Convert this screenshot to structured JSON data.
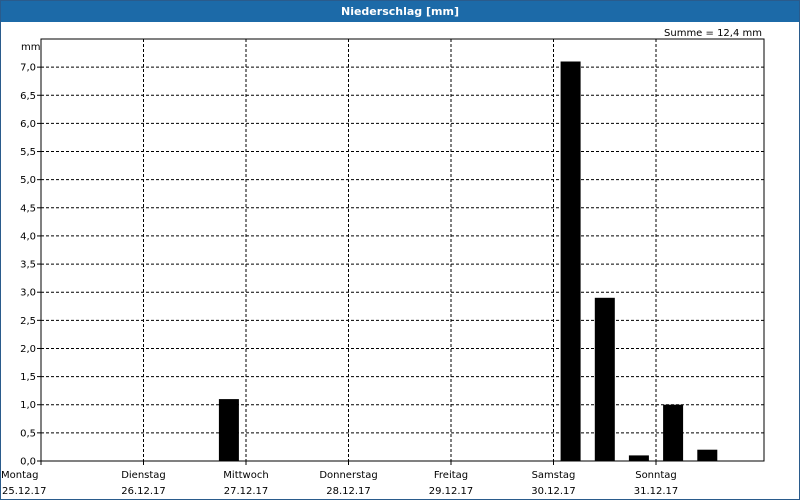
{
  "window": {
    "title": "Niederschlag [mm]"
  },
  "chart_data": {
    "type": "bar",
    "title": "Niederschlag [mm]",
    "ylabel": "mm",
    "summary": "Summe = 12,4 mm",
    "ylim": [
      0,
      7.5
    ],
    "yticks": [
      "0,0",
      "0,5",
      "1,0",
      "1,5",
      "2,0",
      "2,5",
      "3,0",
      "3,5",
      "4,0",
      "4,5",
      "5,0",
      "5,5",
      "6,0",
      "6,5",
      "7,0"
    ],
    "ytick_values": [
      0,
      0.5,
      1.0,
      1.5,
      2.0,
      2.5,
      3.0,
      3.5,
      4.0,
      4.5,
      5.0,
      5.5,
      6.0,
      6.5,
      7.0
    ],
    "days": [
      {
        "weekday": "Montag",
        "date": "25.12.17"
      },
      {
        "weekday": "Dienstag",
        "date": "26.12.17"
      },
      {
        "weekday": "Mittwoch",
        "date": "27.12.17"
      },
      {
        "weekday": "Donnerstag",
        "date": "28.12.17"
      },
      {
        "weekday": "Freitag",
        "date": "29.12.17"
      },
      {
        "weekday": "Samstag",
        "date": "30.12.17"
      },
      {
        "weekday": "Sonntag",
        "date": "31.12.17"
      }
    ],
    "bars": [
      {
        "day": 1,
        "part": 2,
        "value": 1.1
      },
      {
        "day": 5,
        "part": 0,
        "value": 7.1
      },
      {
        "day": 5,
        "part": 1,
        "value": 2.9
      },
      {
        "day": 5,
        "part": 2,
        "value": 0.1
      },
      {
        "day": 6,
        "part": 0,
        "value": 1.0
      },
      {
        "day": 6,
        "part": 1,
        "value": 0.2
      }
    ],
    "bar_color": "#000000",
    "grid": true
  }
}
